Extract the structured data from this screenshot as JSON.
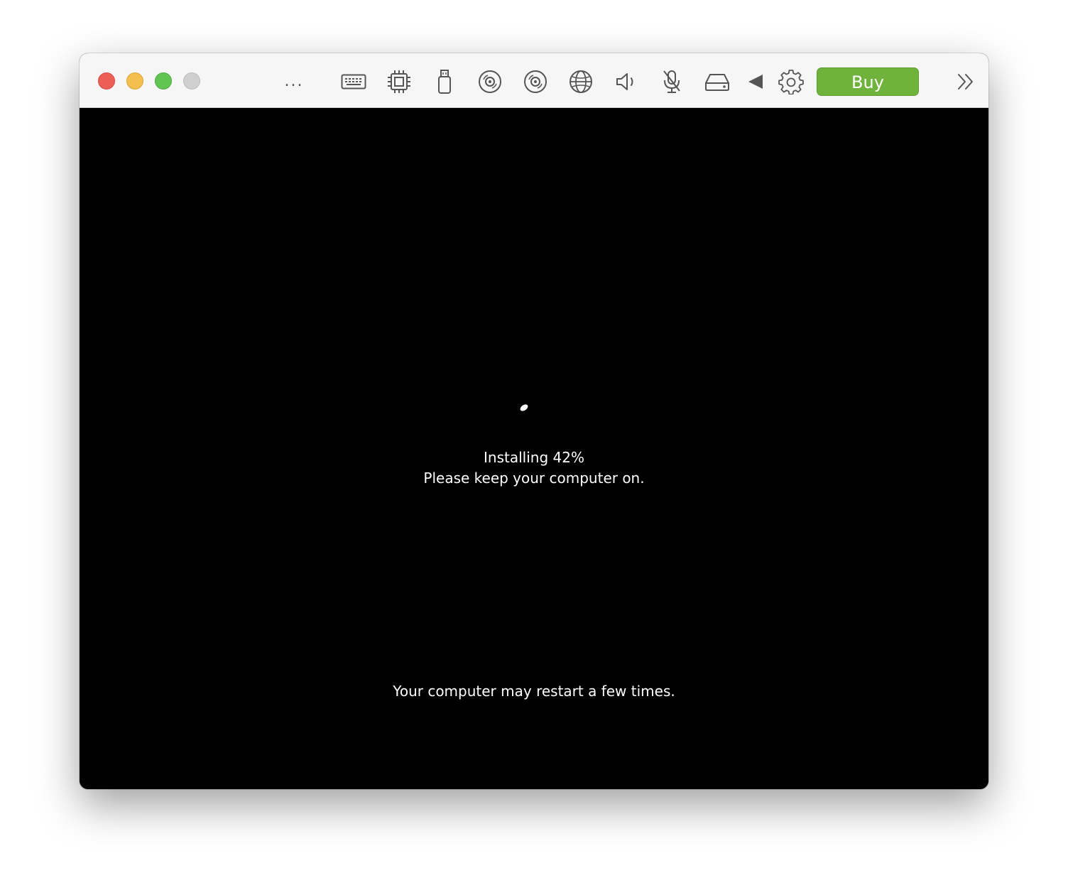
{
  "window": {
    "controls": [
      "close",
      "minimize",
      "zoom",
      "fullscreen"
    ],
    "colors": {
      "close": "#ec5f57",
      "minimize": "#f4bf4f",
      "zoom": "#61c554",
      "inactive": "#cfcfcf"
    }
  },
  "toolbar": {
    "more_label": "...",
    "icons": [
      "keyboard-icon",
      "cpu-icon",
      "usb-icon",
      "cd-icon",
      "dvd-icon",
      "network-icon",
      "speaker-icon",
      "microphone-muted-icon",
      "hard-drive-icon",
      "back-arrow-icon",
      "gear-icon",
      "double-chevron-icon"
    ],
    "buy_label": "Buy",
    "buy_color": "#6fb33c"
  },
  "screen": {
    "installing_label": "Installing  42%",
    "keep_on_label": "Please keep your computer on.",
    "restart_label": "Your computer may restart a few times."
  }
}
